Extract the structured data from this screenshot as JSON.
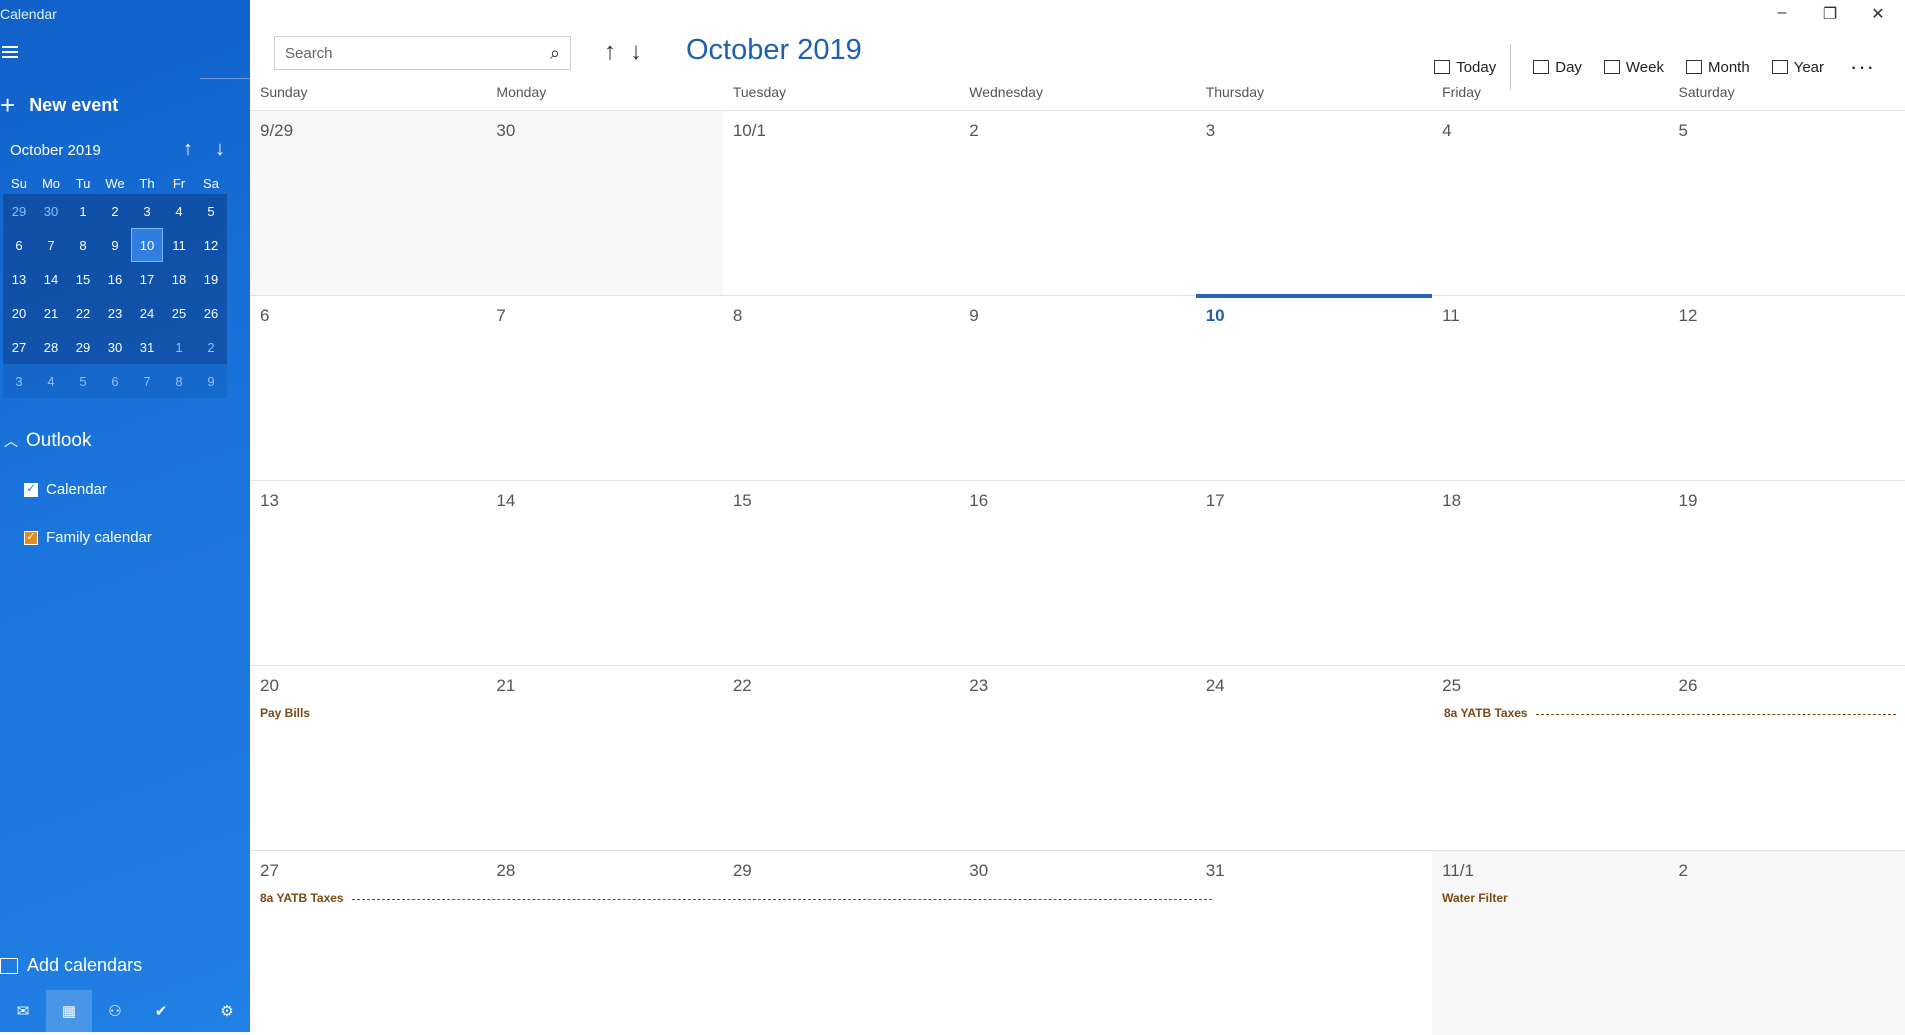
{
  "app": {
    "title": "Calendar"
  },
  "sidebar": {
    "new_event": "New event",
    "mini_cal": {
      "title": "October 2019",
      "dow": [
        "Su",
        "Mo",
        "Tu",
        "We",
        "Th",
        "Fr",
        "Sa"
      ],
      "weeks": [
        [
          "29",
          "30",
          "1",
          "2",
          "3",
          "4",
          "5"
        ],
        [
          "6",
          "7",
          "8",
          "9",
          "10",
          "11",
          "12"
        ],
        [
          "13",
          "14",
          "15",
          "16",
          "17",
          "18",
          "19"
        ],
        [
          "20",
          "21",
          "22",
          "23",
          "24",
          "25",
          "26"
        ],
        [
          "27",
          "28",
          "29",
          "30",
          "31",
          "1",
          "2"
        ],
        [
          "3",
          "4",
          "5",
          "6",
          "7",
          "8",
          "9"
        ]
      ]
    },
    "section": "Outlook",
    "calendars": [
      {
        "label": "Calendar",
        "color": "#1e6fd9"
      },
      {
        "label": "Family calendar",
        "color": "#e38b1f"
      }
    ],
    "add_calendars": "Add calendars"
  },
  "header": {
    "search_placeholder": "Search",
    "month_title": "October 2019",
    "views": [
      "Today",
      "Day",
      "Week",
      "Month",
      "Year"
    ]
  },
  "dow": [
    "Sunday",
    "Monday",
    "Tuesday",
    "Wednesday",
    "Thursday",
    "Friday",
    "Saturday"
  ],
  "month": {
    "weeks": [
      [
        "9/29",
        "30",
        "10/1",
        "2",
        "3",
        "4",
        "5"
      ],
      [
        "6",
        "7",
        "8",
        "9",
        "10",
        "11",
        "12"
      ],
      [
        "13",
        "14",
        "15",
        "16",
        "17",
        "18",
        "19"
      ],
      [
        "20",
        "21",
        "22",
        "23",
        "24",
        "25",
        "26"
      ],
      [
        "27",
        "28",
        "29",
        "30",
        "31",
        "11/1",
        "2"
      ]
    ],
    "events": {
      "pay_bills": "Pay Bills",
      "yatb1": "8a YATB Taxes",
      "yatb2": "8a YATB Taxes",
      "water_filter": "Water Filter"
    }
  },
  "colors": {
    "accent": "#1e5fb4",
    "sidebar": "#1a74db",
    "event_text": "#7a4a14"
  }
}
